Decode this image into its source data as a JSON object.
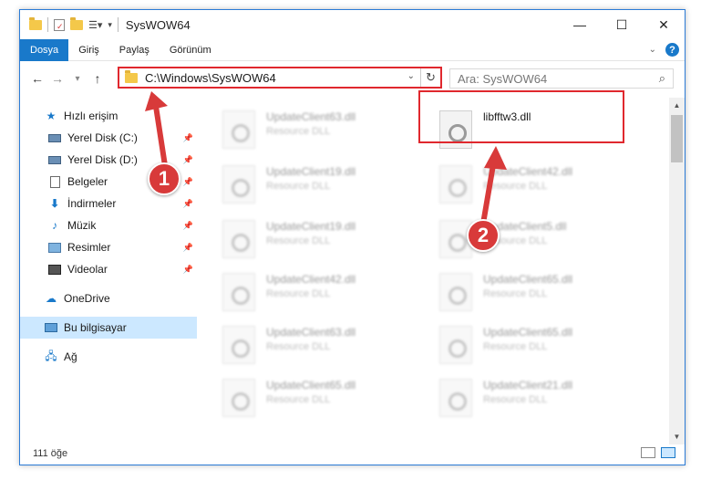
{
  "window": {
    "title": "SysWOW64",
    "controls": {
      "minimize": "—",
      "maximize": "☐",
      "close": "✕"
    }
  },
  "ribbon": {
    "tabs": [
      "Dosya",
      "Giriş",
      "Paylaş",
      "Görünüm"
    ],
    "active_tab": "Dosya",
    "help": "?"
  },
  "navigation": {
    "back": "←",
    "forward": "→",
    "recent": "▾",
    "up": "↑",
    "address": "C:\\Windows\\SysWOW64",
    "search_placeholder": "Ara: SysWOW64"
  },
  "sidebar": {
    "quick_access": "Hızlı erişim",
    "items": [
      {
        "label": "Yerel Disk (C:)",
        "icon": "drive-icon",
        "pinned": true
      },
      {
        "label": "Yerel Disk (D:)",
        "icon": "drive-icon",
        "pinned": true
      },
      {
        "label": "Belgeler",
        "icon": "documents-icon",
        "pinned": true
      },
      {
        "label": "İndirmeler",
        "icon": "downloads-icon",
        "pinned": true
      },
      {
        "label": "Müzik",
        "icon": "music-icon",
        "pinned": true
      },
      {
        "label": "Resimler",
        "icon": "pictures-icon",
        "pinned": true
      },
      {
        "label": "Videolar",
        "icon": "videos-icon",
        "pinned": true
      }
    ],
    "onedrive": "OneDrive",
    "this_pc": "Bu bilgisayar",
    "network": "Ağ"
  },
  "files": {
    "left_column": [
      {
        "name": "UpdateClient63.dll",
        "type": "Resource DLL"
      },
      {
        "name": "UpdateClient19.dll",
        "type": "Resource DLL"
      },
      {
        "name": "UpdateClient19.dll",
        "type": "Resource DLL"
      },
      {
        "name": "UpdateClient42.dll",
        "type": "Resource DLL"
      },
      {
        "name": "UpdateClient63.dll",
        "type": "Resource DLL"
      },
      {
        "name": "UpdateClient65.dll",
        "type": "Resource DLL"
      }
    ],
    "right_column": [
      {
        "name": "libfftw3.dll",
        "type": ""
      },
      {
        "name": "UpdateClient42.dll",
        "type": "Resource DLL"
      },
      {
        "name": "UpdateClient5.dll",
        "type": "Resource DLL"
      },
      {
        "name": "UpdateClient65.dll",
        "type": "Resource DLL"
      },
      {
        "name": "UpdateClient65.dll",
        "type": "Resource DLL"
      },
      {
        "name": "UpdateClient21.dll",
        "type": "Resource DLL"
      }
    ]
  },
  "annotations": {
    "step1": "1",
    "step2": "2"
  },
  "status": {
    "item_count": "111 öğe"
  },
  "colors": {
    "accent": "#1979ca",
    "highlight": "#e0282e"
  }
}
